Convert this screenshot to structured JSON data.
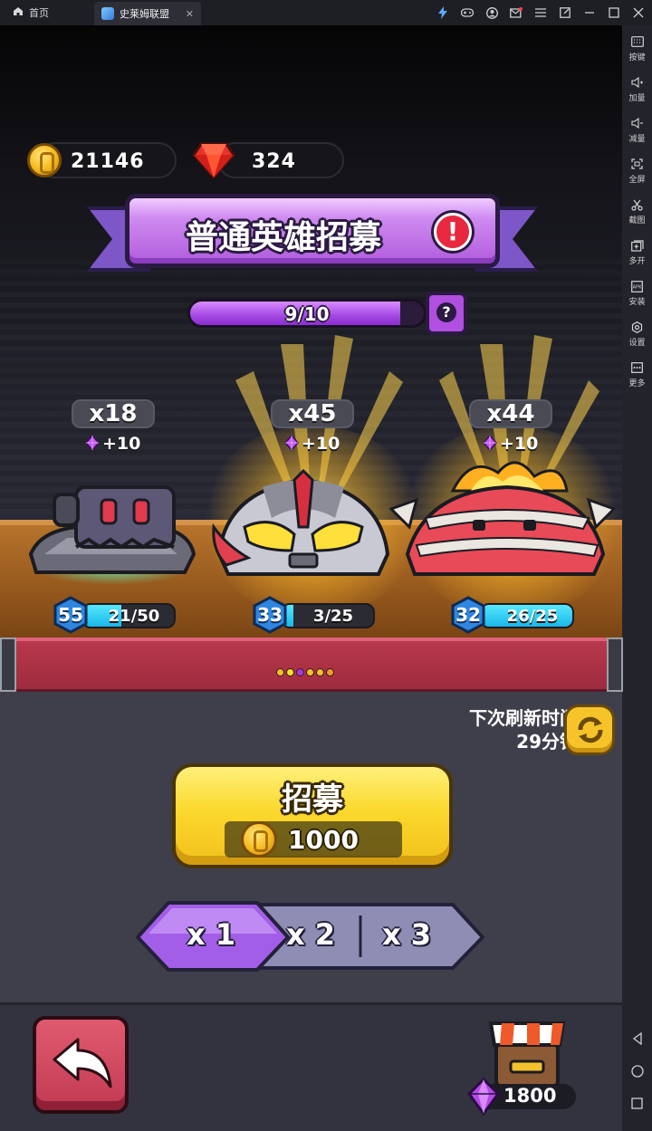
{
  "window": {
    "home_tab": "首页",
    "game_tab": "史莱姆联盟",
    "tab_close": "✕"
  },
  "topbar_icons": [
    "lightning-icon",
    "gamepad-icon",
    "account-icon",
    "mail-icon",
    "menu-icon",
    "popout-icon",
    "minimize-icon",
    "maximize-icon",
    "close-icon"
  ],
  "sidebar": {
    "items": [
      {
        "label": "按键",
        "icon": "keyboard-icon"
      },
      {
        "label": "加量",
        "icon": "volume-up-icon"
      },
      {
        "label": "减量",
        "icon": "volume-down-icon"
      },
      {
        "label": "全屏",
        "icon": "fullscreen-icon"
      },
      {
        "label": "截图",
        "icon": "scissors-icon"
      },
      {
        "label": "多开",
        "icon": "multi-instance-icon"
      },
      {
        "label": "安装",
        "icon": "apk-install-icon"
      },
      {
        "label": "设置",
        "icon": "settings-icon"
      },
      {
        "label": "更多",
        "icon": "more-icon"
      }
    ],
    "nav": [
      "back-icon",
      "home-icon",
      "recents-icon"
    ]
  },
  "currency": {
    "gold": "21146",
    "ruby": "324"
  },
  "banner": {
    "title": "普通英雄招募",
    "alert": "!"
  },
  "progress": {
    "text": "9/10",
    "current": 9,
    "max": 10,
    "help": "?"
  },
  "heroes": [
    {
      "count": "x18",
      "gem_bonus": "+10",
      "level": "55",
      "shards": "21/50",
      "shard_fraction": 0.42,
      "name": "robot-slime"
    },
    {
      "count": "x45",
      "gem_bonus": "+10",
      "level": "33",
      "shards": "3/25",
      "shard_fraction": 0.12,
      "name": "ultra-slime"
    },
    {
      "count": "x44",
      "gem_bonus": "+10",
      "level": "32",
      "shards": "26/25",
      "shard_fraction": 1.0,
      "name": "fire-mummy-slime"
    }
  ],
  "carousel": {
    "dot_colors": [
      "#f2c12b",
      "#f2e82b",
      "#a23be0",
      "#f2c12b",
      "#f2c12b",
      "#f29a2b"
    ]
  },
  "refresh": {
    "line1": "下次刷新时间",
    "line2": "29分钟"
  },
  "recruit": {
    "label": "招募",
    "cost": "1000"
  },
  "multiplier": {
    "options": [
      "x 1",
      "x 2",
      "x 3"
    ],
    "selected": "x 1"
  },
  "shop": {
    "price": "1800"
  },
  "colors": {
    "purple_accent": "#b05bdc",
    "gold": "#fbd82c",
    "shard_cyan": "#18b6e8",
    "back_red": "#c23a52"
  }
}
